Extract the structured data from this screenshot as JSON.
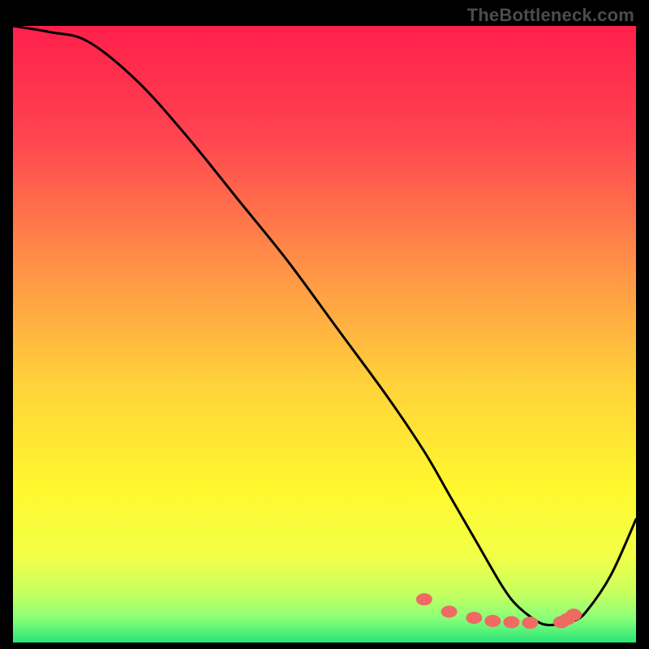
{
  "watermark": "TheBottleneck.com",
  "chart_data": {
    "type": "line",
    "title": "",
    "xlabel": "",
    "ylabel": "",
    "xlim": [
      0,
      100
    ],
    "ylim": [
      0,
      100
    ],
    "grid": false,
    "legend": false,
    "series": [
      {
        "name": "curve",
        "x": [
          0,
          6,
          12,
          20,
          28,
          36,
          44,
          52,
          60,
          66,
          70,
          74,
          78,
          80,
          82,
          85,
          88,
          90,
          92,
          96,
          100
        ],
        "values": [
          100,
          99,
          97.5,
          91,
          82,
          72,
          62,
          51,
          40,
          31,
          24,
          17,
          10,
          7,
          5,
          3,
          3,
          3.5,
          5,
          11,
          20
        ]
      }
    ],
    "markers": {
      "name": "highlight-dots",
      "color": "#ef6a62",
      "x": [
        66,
        70,
        74,
        77,
        80,
        83,
        88,
        89,
        90
      ],
      "values": [
        7,
        5,
        4,
        3.5,
        3.3,
        3.2,
        3.3,
        3.8,
        4.5
      ]
    },
    "background_gradient": {
      "stops": [
        {
          "offset": 0.0,
          "color": "#ff1f4b"
        },
        {
          "offset": 0.18,
          "color": "#ff4450"
        },
        {
          "offset": 0.38,
          "color": "#ff8e48"
        },
        {
          "offset": 0.58,
          "color": "#ffd23a"
        },
        {
          "offset": 0.75,
          "color": "#fff82e"
        },
        {
          "offset": 0.86,
          "color": "#f2ff47"
        },
        {
          "offset": 0.92,
          "color": "#c6ff60"
        },
        {
          "offset": 0.96,
          "color": "#8bff78"
        },
        {
          "offset": 1.0,
          "color": "#28e57a"
        }
      ]
    }
  }
}
